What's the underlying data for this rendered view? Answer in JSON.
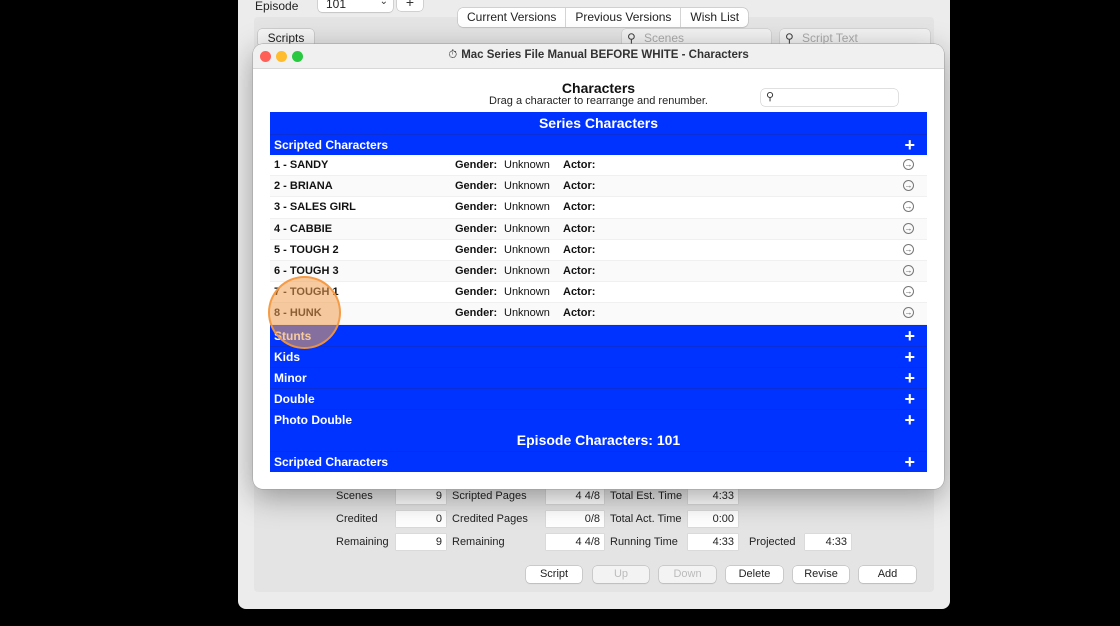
{
  "main": {
    "episode_label": "Episode",
    "episode_value": "101",
    "tabs": [
      "Current Versions",
      "Previous Versions",
      "Wish List"
    ],
    "scripts_tab": "Scripts",
    "scenes_search_placeholder": "Scenes",
    "script_text_placeholder": "Script Text",
    "stats": {
      "scenes_label": "Scenes",
      "scenes_value": "9",
      "scripted_pages_label": "Scripted Pages",
      "scripted_pages_value": "4 4/8",
      "total_est_label": "Total Est. Time",
      "total_est_value": "4:33",
      "credited_label": "Credited",
      "credited_value": "0",
      "credited_pages_label": "Credited Pages",
      "credited_pages_value": "0/8",
      "total_act_label": "Total Act. Time",
      "total_act_value": "0:00",
      "remaining_label": "Remaining",
      "remaining_value": "9",
      "remaining_pages_label": "Remaining",
      "remaining_pages_value": "4 4/8",
      "running_label": "Running Time",
      "running_value": "4:33",
      "projected_label": "Projected",
      "projected_value": "4:33"
    },
    "buttons": {
      "script": "Script",
      "up": "Up",
      "down": "Down",
      "delete": "Delete",
      "revise": "Revise",
      "add": "Add"
    }
  },
  "char_window": {
    "title": "Mac Series File Manual  BEFORE WHITE - Characters",
    "watch_icon": "⏱",
    "heading": "Characters",
    "subheading": "Drag a character to rearrange and renumber.",
    "series_band": "Series Characters",
    "scripted_band": "Scripted Characters",
    "gender_label": "Gender:",
    "actor_label": "Actor:",
    "characters": [
      {
        "name": "1 - SANDY",
        "gender": "Unknown"
      },
      {
        "name": "2 - BRIANA",
        "gender": "Unknown"
      },
      {
        "name": "3 - SALES GIRL",
        "gender": "Unknown"
      },
      {
        "name": "4 - CABBIE",
        "gender": "Unknown"
      },
      {
        "name": "5 - TOUGH 2",
        "gender": "Unknown"
      },
      {
        "name": "6 - TOUGH 3",
        "gender": "Unknown"
      },
      {
        "name": "7 - TOUGH 1",
        "gender": "Unknown"
      },
      {
        "name": "8 - HUNK",
        "gender": "Unknown"
      }
    ],
    "categories": [
      "Stunts",
      "Kids",
      "Minor",
      "Double",
      "Photo Double"
    ],
    "episode_band": "Episode Characters: 101",
    "episode_scripted_band": "Scripted Characters",
    "plus_glyph": "+",
    "go_glyph": "→"
  },
  "colors": {
    "band_blue": "#0033ff",
    "highlight": "#f0a050"
  }
}
